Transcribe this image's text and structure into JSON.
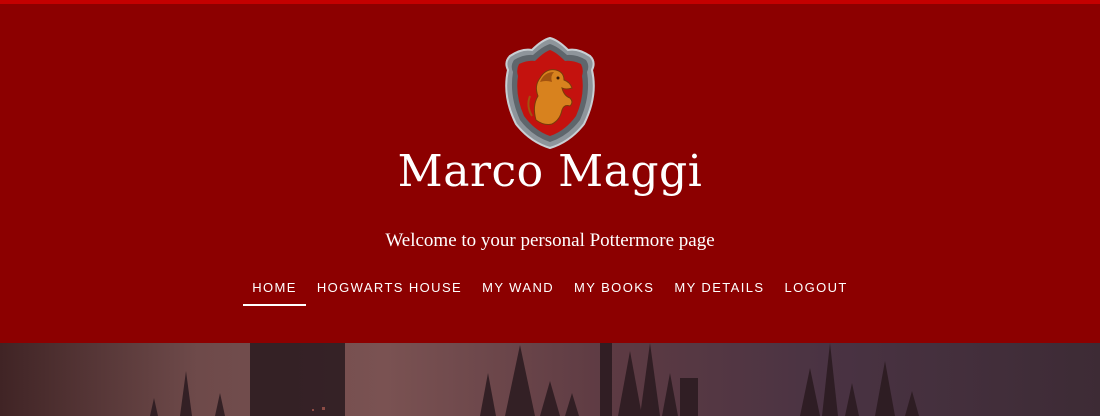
{
  "header": {
    "user_name": "Marco Maggi",
    "welcome_text": "Welcome to your personal Pottermore page"
  },
  "nav": {
    "items": [
      {
        "label": "HOME",
        "active": true
      },
      {
        "label": "HOGWARTS HOUSE",
        "active": false
      },
      {
        "label": "MY WAND",
        "active": false
      },
      {
        "label": "MY BOOKS",
        "active": false
      },
      {
        "label": "MY DETAILS",
        "active": false
      },
      {
        "label": "LOGOUT",
        "active": false
      }
    ]
  },
  "theme": {
    "header_bg": "#8c0000",
    "top_strip": "#c40000",
    "text": "#ffffff"
  },
  "icons": {
    "crest": "gryffindor-crest-icon"
  }
}
